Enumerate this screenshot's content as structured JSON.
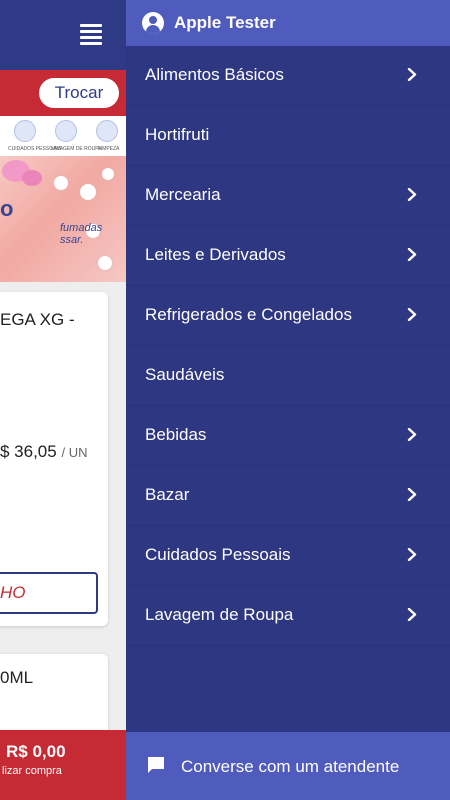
{
  "background_app": {
    "change_button_label": "Trocar",
    "categories": [
      {
        "label": "CUIDADOS PESSOAIS",
        "icon": "personal-care-icon"
      },
      {
        "label": "LAVAGEM DE ROUPA",
        "icon": "laundry-icon"
      },
      {
        "label": "LIMPEZA",
        "icon": "cleaning-icon"
      }
    ],
    "banner_text": "fumadas\nssar.",
    "banner_logo": "o",
    "product1": {
      "title": "EGA XG -",
      "price": "$ 36,05",
      "unit": "/ UN",
      "button_label": "HO"
    },
    "product2": {
      "title": "0ML"
    },
    "footer": {
      "total": "R$ 0,00",
      "subtitle": "lizar compra"
    }
  },
  "drawer": {
    "user_name": "Apple Tester",
    "menu_items": [
      {
        "label": "Alimentos Básicos",
        "has_submenu": true
      },
      {
        "label": "Hortifruti",
        "has_submenu": false
      },
      {
        "label": "Mercearia",
        "has_submenu": true
      },
      {
        "label": "Leites e Derivados",
        "has_submenu": true
      },
      {
        "label": "Refrigerados e Congelados",
        "has_submenu": true
      },
      {
        "label": "Saudáveis",
        "has_submenu": false
      },
      {
        "label": "Bebidas",
        "has_submenu": true
      },
      {
        "label": "Bazar",
        "has_submenu": true
      },
      {
        "label": "Cuidados Pessoais",
        "has_submenu": true
      },
      {
        "label": "Lavagem de Roupa",
        "has_submenu": true
      }
    ],
    "footer_chat_label": "Converse com um atendente"
  },
  "colors": {
    "drawer_bg": "#2e3781",
    "drawer_accent": "#4f5bbd",
    "brand_red": "#c62b35",
    "brand_blue": "#2f3a86"
  }
}
